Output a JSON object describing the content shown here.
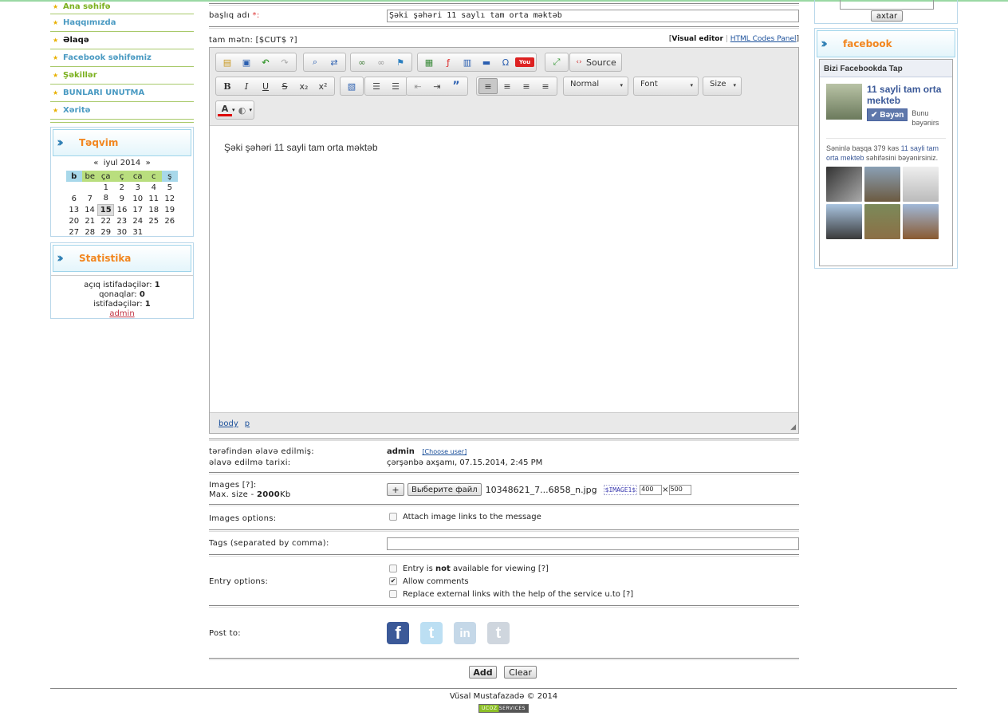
{
  "nav": {
    "items": [
      {
        "label": "Ana səhifə",
        "style": "green"
      },
      {
        "label": "Haqqımızda",
        "style": "blue"
      },
      {
        "label": "Əlaqə",
        "style": "black"
      },
      {
        "label": "Facebook səhifəmiz",
        "style": "blue"
      },
      {
        "label": "Şəkillər",
        "style": "green"
      },
      {
        "label": "BUNLARI UNUTMA",
        "style": "blue"
      },
      {
        "label": "Xəritə",
        "style": "blue"
      }
    ]
  },
  "calendar": {
    "title": "Təqvim",
    "prev": "«",
    "month": "iyul 2014",
    "next": "»",
    "weekdays": [
      "b",
      "be",
      "ça",
      "ç",
      "ca",
      "c",
      "ş"
    ],
    "weeks": [
      [
        "",
        "",
        "1",
        "2",
        "3",
        "4",
        "5"
      ],
      [
        "6",
        "7",
        "8",
        "9",
        "10",
        "11",
        "12"
      ],
      [
        "13",
        "14",
        "15",
        "16",
        "17",
        "18",
        "19"
      ],
      [
        "20",
        "21",
        "22",
        "23",
        "24",
        "25",
        "26"
      ],
      [
        "27",
        "28",
        "29",
        "30",
        "31",
        "",
        ""
      ]
    ],
    "today": "15"
  },
  "stats": {
    "title": "Statistika",
    "online_label": "açıq istifadəçilər:",
    "online": "1",
    "guests_label": "qonaqlar:",
    "guests": "0",
    "users_label": "istifadəçilər:",
    "users": "1",
    "admin_link": "admin"
  },
  "form": {
    "title_label": "başlıq adı",
    "required_mark": "*:",
    "title_value": "Şəki şəhəri 11 saylı tam orta məktəb",
    "text_label": "tam mətn: [$CUT$ ?]",
    "visual_editor": "Visual editor",
    "sep": "|",
    "html_panel": "HTML Codes Panel",
    "source_label": "Source",
    "format_dd": "Normal",
    "font_dd": "Font",
    "size_dd": "Size",
    "editor_text": "Şəki şəhəri 11 sayli tam orta məktəb",
    "path_body": "body",
    "path_p": "p",
    "added_by_label": "tərəfindən əlavə edilmiş:",
    "added_by": "admin",
    "choose_user": "[Choose user]",
    "date_label": "əlavə edilmə tarixi:",
    "date_value": "çərşənbə axşamı, 07.15.2014, 2:45 PM",
    "images_label": "Images [?]:",
    "maxsize_label": "Max. size -",
    "maxsize_value": "2000",
    "maxsize_unit": "Kb",
    "plus": "+",
    "choose_file": "Выберите файл",
    "file_name": "10348621_7...6858_n.jpg",
    "image_code": "$IMAGE1$",
    "img_w": "400",
    "img_x": "×",
    "img_h": "500",
    "images_options_label": "Images options:",
    "attach_links": "Attach image links to the message",
    "tags_label": "Tags (separated by comma):",
    "entry_options_label": "Entry options:",
    "opt1_a": "Entry is",
    "opt1_b": "not",
    "opt1_c": "available for viewing [?]",
    "opt2": "Allow comments",
    "opt3": "Replace external links with the help of the service u.to [?]",
    "post_to_label": "Post to:",
    "add_btn": "Add",
    "clear_btn": "Clear"
  },
  "right": {
    "search_btn": "axtar",
    "facebook_title": "facebook",
    "fb_header": "Bizi Facebookda Tap",
    "fb_page": "11 sayli tam orta mekteb",
    "like_btn": "Bəyən",
    "like_note": "Bunu bəyənirs",
    "fb_text1": "Səninlə başqa 379 kəs",
    "fb_text_link": "11 sayli tam orta mekteb",
    "fb_text2": "səhifəsini bəyənirsiniz."
  },
  "footer": {
    "copyright": "Vüsal Mustafazadə © 2014",
    "badge": "UCOZ SERVICES"
  },
  "colors": {
    "accent": "#f2861f",
    "nav_green": "#7bb01e",
    "nav_blue": "#4a9ac2",
    "facebook": "#3b5998"
  }
}
